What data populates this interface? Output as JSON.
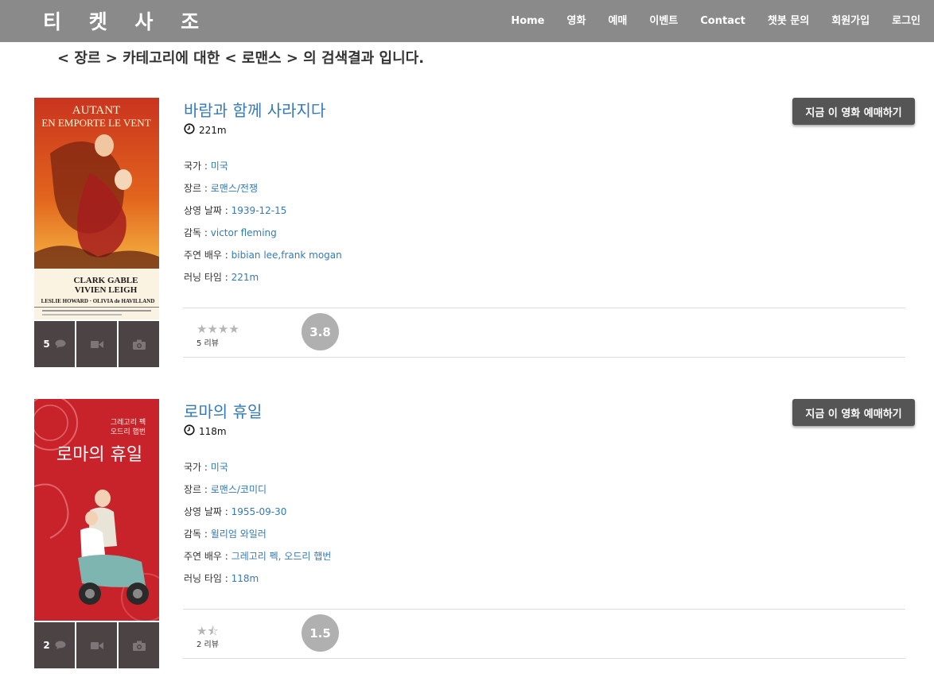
{
  "brand": "티 켓 사 조",
  "nav": [
    "Home",
    "영화",
    "예매",
    "이벤트",
    "Contact",
    "챗봇 문의",
    "회원가입",
    "로그인"
  ],
  "heading": "< 장르 > 카테고리에 대한 < 로맨스 > 의 검색결과 입니다.",
  "labels": {
    "country": "국가 : ",
    "genre": "장르 : ",
    "release": "상영 날짜 : ",
    "director": "감독 : ",
    "cast": "주연 배우 : ",
    "running": "러닝 타임 : ",
    "book_button": "지금 이 영화 예매하기"
  },
  "icons": {
    "clock": "clock-icon",
    "comment": "comment-icon",
    "video": "video-icon",
    "camera": "camera-icon"
  },
  "movies": [
    {
      "title": "바람과 함께 사라지다",
      "runtime": "221m",
      "country": "미국",
      "genre": "로맨스/전쟁",
      "release": "1939-12-15",
      "director": "victor fleming",
      "cast": "bibian lee,frank mogan",
      "running": "221m",
      "comment_count": "5",
      "stars": "★★★★",
      "reviews": "5 리뷰",
      "score": "3.8",
      "poster_text": [
        "AUTANT",
        "EN EMPORTE LE VENT",
        "CLARK GABLE",
        "VIVIEN LEIGH",
        "LESLIE HOWARD · OLIVIA de HAVILLAND"
      ]
    },
    {
      "title": "로마의 휴일",
      "runtime": "118m",
      "country": "미국",
      "genre": "로맨스/코미디",
      "release": "1955-09-30",
      "director": "윌리엄 와일러",
      "cast": "그레고리 펙, 오드리 햅번",
      "running": "118m",
      "comment_count": "2",
      "stars": "★⯪",
      "reviews": "2 리뷰",
      "score": "1.5",
      "poster_text": [
        "그레고리 펙",
        "오드리 햅번",
        "로마의 휴일"
      ]
    }
  ],
  "colors": {
    "navbar": "#8a8a8a",
    "link": "#337ab7",
    "button": "#555555",
    "tile": "#4b4344",
    "score_circle": "#b0b0b0"
  }
}
